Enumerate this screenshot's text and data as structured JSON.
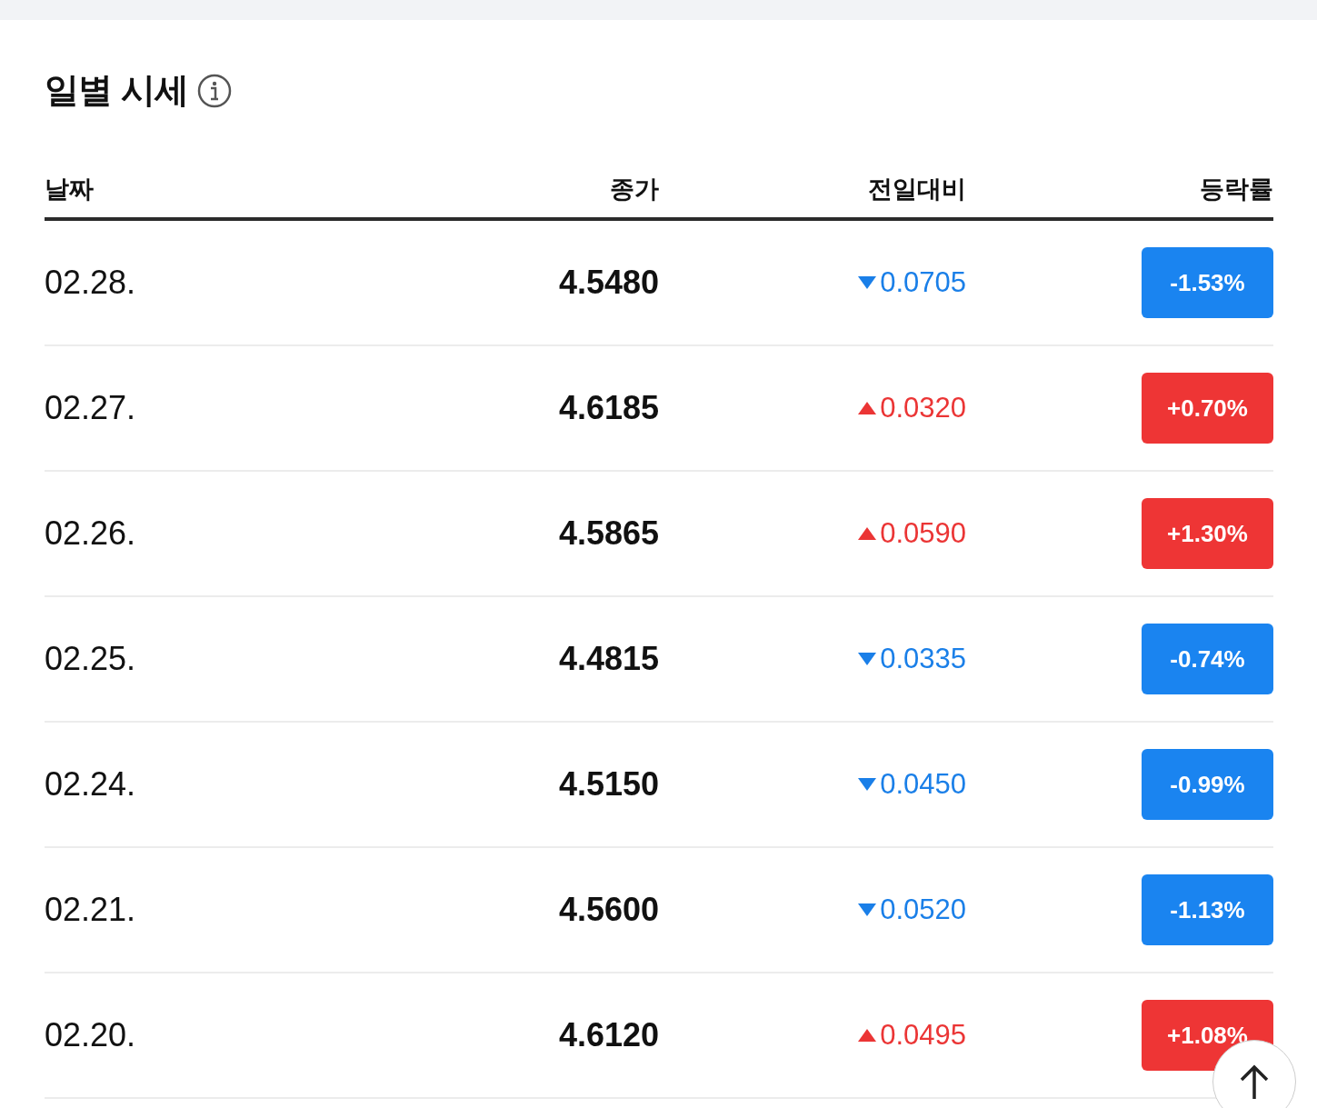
{
  "title": "일별 시세",
  "columns": [
    "날짜",
    "종가",
    "전일대비",
    "등락률"
  ],
  "rows": [
    {
      "date": "02.28.",
      "close": "4.5480",
      "change": "0.0705",
      "kind": "down",
      "rate": "-1.53%"
    },
    {
      "date": "02.27.",
      "close": "4.6185",
      "change": "0.0320",
      "kind": "up",
      "rate": "+0.70%"
    },
    {
      "date": "02.26.",
      "close": "4.5865",
      "change": "0.0590",
      "kind": "up",
      "rate": "+1.30%"
    },
    {
      "date": "02.25.",
      "close": "4.4815",
      "change": "0.0335",
      "kind": "down",
      "rate": "-0.74%"
    },
    {
      "date": "02.24.",
      "close": "4.5150",
      "change": "0.0450",
      "kind": "down",
      "rate": "-0.99%"
    },
    {
      "date": "02.21.",
      "close": "4.5600",
      "change": "0.0520",
      "kind": "down",
      "rate": "-1.13%"
    },
    {
      "date": "02.20.",
      "close": "4.6120",
      "change": "0.0495",
      "kind": "up",
      "rate": "+1.08%"
    }
  ]
}
